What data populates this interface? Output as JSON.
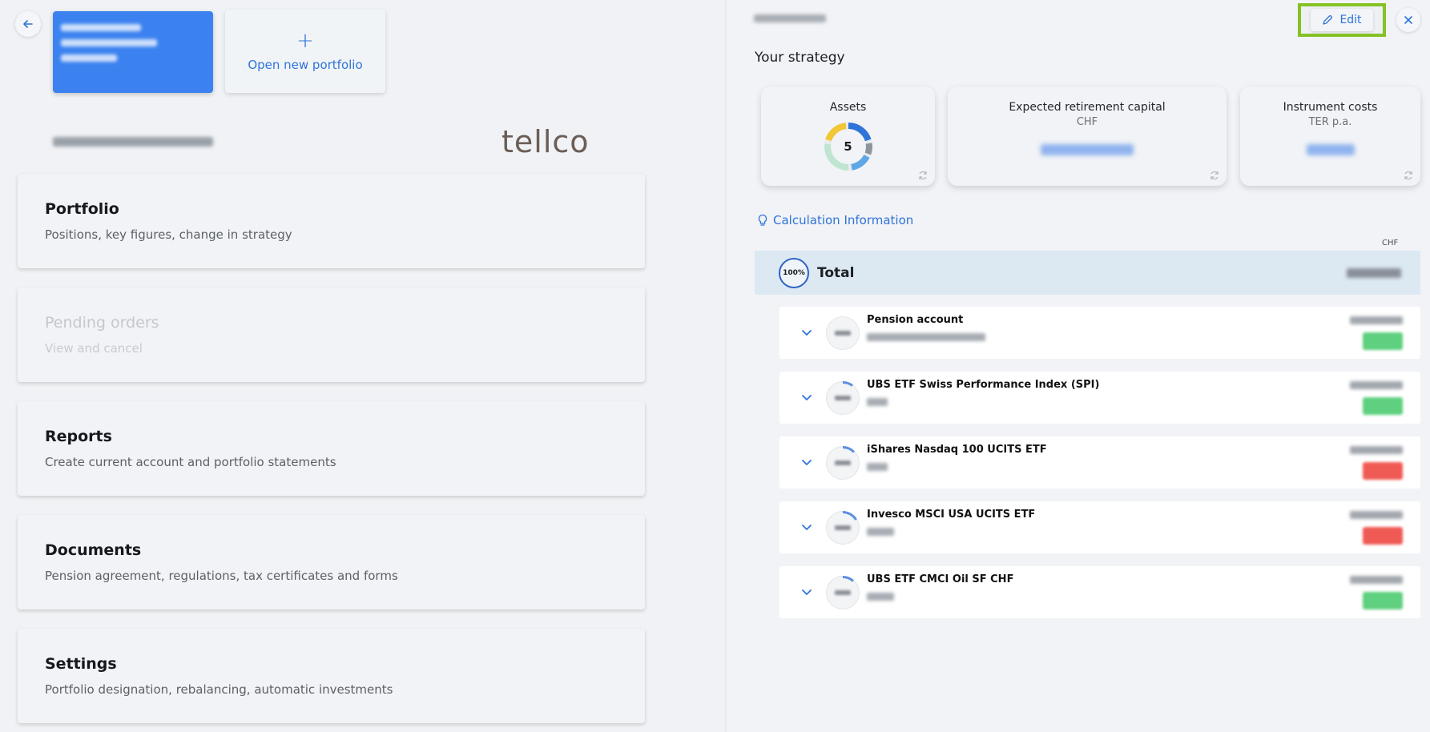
{
  "left": {
    "back_icon": "arrow-left-icon",
    "new_portfolio": {
      "icon": "plus-icon",
      "label": "Open new portfolio",
      "plus": "+"
    },
    "provider_logo": "tellco",
    "menu": [
      {
        "title": "Portfolio",
        "subtitle": "Positions, key figures, change in strategy",
        "disabled": false
      },
      {
        "title": "Pending orders",
        "subtitle": "View and cancel",
        "disabled": true
      },
      {
        "title": "Reports",
        "subtitle": "Create current account and portfolio statements",
        "disabled": false
      },
      {
        "title": "Documents",
        "subtitle": "Pension agreement, regulations, tax certificates and forms",
        "disabled": false
      },
      {
        "title": "Settings",
        "subtitle": "Portfolio designation, rebalancing, automatic investments",
        "disabled": false
      }
    ]
  },
  "right": {
    "edit_label": "Edit",
    "edit_icon": "pencil-icon",
    "close_icon": "close-icon",
    "section_title": "Your strategy",
    "stats": {
      "assets": {
        "title": "Assets",
        "count": "5"
      },
      "retirement": {
        "title": "Expected retirement capital",
        "sub": "CHF"
      },
      "costs": {
        "title": "Instrument costs",
        "sub": "TER p.a."
      }
    },
    "calc_info": "Calculation Information",
    "currency": "CHF",
    "total": {
      "percent": "100%",
      "label": "Total"
    },
    "positions": [
      {
        "name": "Pension account",
        "badge": "green"
      },
      {
        "name": "UBS ETF Swiss Performance Index (SPI)",
        "badge": "green"
      },
      {
        "name": "iShares Nasdaq 100 UCITS ETF",
        "badge": "red"
      },
      {
        "name": "Invesco MSCI USA UCITS ETF",
        "badge": "red"
      },
      {
        "name": "UBS ETF CMCI Oil SF CHF",
        "badge": "green"
      }
    ],
    "colors": {
      "accent": "#2f74d8",
      "highlight": "#84c225",
      "positive": "#5fd07f",
      "negative": "#f05a54"
    }
  }
}
